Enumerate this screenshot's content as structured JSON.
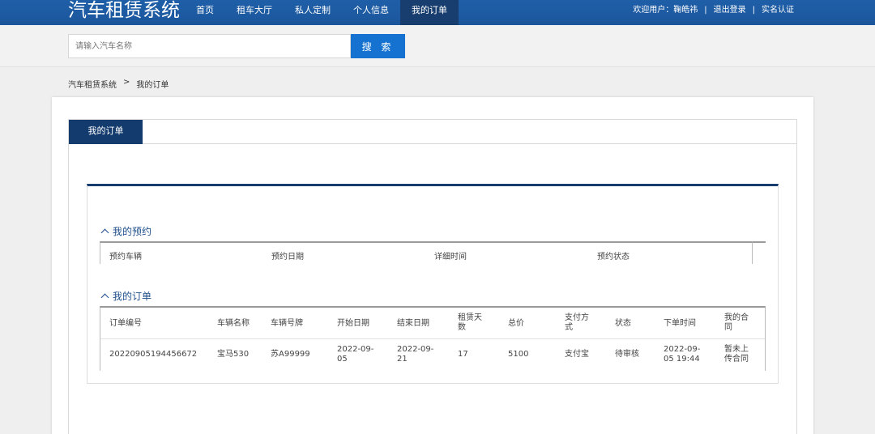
{
  "header": {
    "logo": "汽车租赁系统",
    "nav": [
      "首页",
      "租车大厅",
      "私人定制",
      "个人信息",
      "我的订单"
    ],
    "active_nav": "我的订单",
    "welcome": "欢迎用户：鞠皓祎",
    "logout": "退出登录",
    "verify": "实名认证",
    "sep": "|"
  },
  "search": {
    "placeholder": "请输入汽车名称",
    "button": "搜 索"
  },
  "breadcrumb": {
    "root": "汽车租赁系统",
    "sep": ">",
    "current": "我的订单"
  },
  "tab": {
    "label": "我的订单"
  },
  "reservations": {
    "title": "我的预约",
    "headers": [
      "预约车辆",
      "预约日期",
      "详细时间",
      "预约状态"
    ]
  },
  "orders": {
    "title": "我的订单",
    "headers": [
      "订单编号",
      "车辆名称",
      "车辆号牌",
      "开始日期",
      "结束日期",
      "租赁天数",
      "总价",
      "支付方式",
      "状态",
      "下单时间",
      "我的合同"
    ],
    "rows": [
      [
        "20220905194456672",
        "宝马530",
        "苏A99999",
        "2022-09-05",
        "2022-09-21",
        "17",
        "5100",
        "支付宝",
        "待审核",
        "2022-09-05 19:44",
        "暂未上传合同"
      ]
    ]
  }
}
